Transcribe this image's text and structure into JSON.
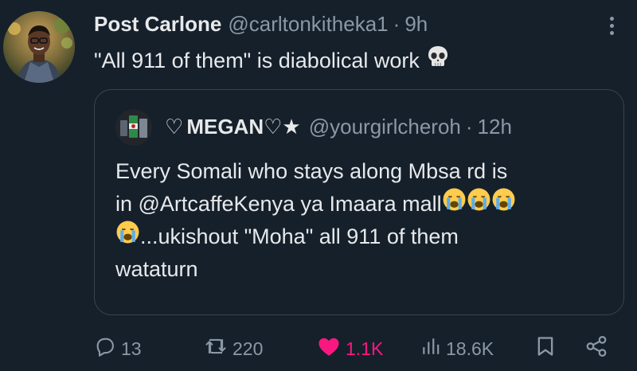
{
  "tweet": {
    "author_name": "Post Carlone",
    "author_handle": "@carltonkitheka1",
    "separator": "·",
    "time": "9h",
    "text": "\"All 911 of them\" is diabolical work",
    "text_emoji": "skull-emoji"
  },
  "quote": {
    "name_prefix": "♡",
    "name": "MEGAN♡★",
    "handle": "@yourgirlcheroh",
    "separator": "·",
    "time": "12h",
    "line1": "Every Somali who stays  along Mbsa rd is",
    "line2": "in @ArtcaffeKenya ya Imaara mall",
    "line3": "...ukishout \"Moha\"  all 911 of them",
    "line4": "wataturn",
    "emoji": "loudly-crying-face"
  },
  "actions": {
    "replies": "13",
    "reposts": "220",
    "likes": "1.1K",
    "views": "18.6K"
  },
  "colors": {
    "background": "#15202b",
    "text": "#e7e9ea",
    "muted": "#8b98a5",
    "border": "#38444d",
    "like": "#f91880"
  }
}
